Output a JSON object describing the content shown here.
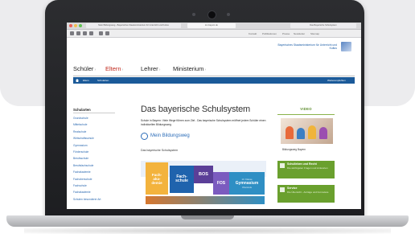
{
  "browser": {
    "tabs": [
      "Mein Bildungsweg - Bayerisches Staatsministerium für Unterricht und Kultus",
      "Das Bayerische Schulsystem"
    ],
    "address": "km.bayern.de",
    "top_links": [
      "Kontakt",
      "Publikationen",
      "Presse",
      "Newsletter",
      "Sitemap"
    ]
  },
  "site": {
    "ministry_text": "Bayerisches Staatsministerium für Unterricht und Kultus",
    "main_nav": [
      {
        "label": "Schüler",
        "active": false
      },
      {
        "label": "Eltern",
        "active": true
      },
      {
        "label": "Lehrer",
        "active": false
      },
      {
        "label": "Ministerium",
        "active": false
      }
    ],
    "breadcrumb": [
      "Eltern",
      "Schularten"
    ],
    "bar_right": "Weiterempfehlen"
  },
  "sidebar": {
    "title": "Schularten",
    "items": [
      "Grundschule",
      "Mittelschule",
      "Realschule",
      "Wirtschaftsschule",
      "Gymnasium",
      "Förderschule",
      "Berufsschule",
      "Berufsfachschule",
      "Fachakademie",
      "Fachoberschule",
      "Fachschule",
      "Fachakademie",
      "Schulen besonderer Art"
    ]
  },
  "main": {
    "heading": "Das bayerische Schulsystem",
    "intro": "Schule in Bayern: Viele Wege führen zum Ziel - Das bayerische Schulsystem eröffnet jedem Schüler einen individuellen Bildungsweg.",
    "bildungsweg": "Mein Bildungsweg",
    "schema_label": "Das bayerische Schulsystem",
    "diagram": {
      "fachakademie": "Fach-\naka-\ndemie",
      "fachschule": "Fach-\nschule",
      "bos": "BOS",
      "fos": "FOS",
      "gymnasium_top": "13. Klasse",
      "gymnasium": "Gymnasium",
      "gymnasium_sub": "Oberstufe"
    }
  },
  "right": {
    "video_heading": "VIDEO",
    "video_caption": "Bildungsweg Bayern",
    "boxes": [
      {
        "title": "Schulleben und Recht",
        "sub": "Die wichtigsten Fragen und Antworten"
      },
      {
        "title": "Service",
        "sub": "Die Übersicht - Anträge und Formulare"
      }
    ]
  },
  "colors": {
    "brand_blue": "#1b5a99",
    "active_red": "#c0281c",
    "accent_green": "#6aa02e"
  }
}
